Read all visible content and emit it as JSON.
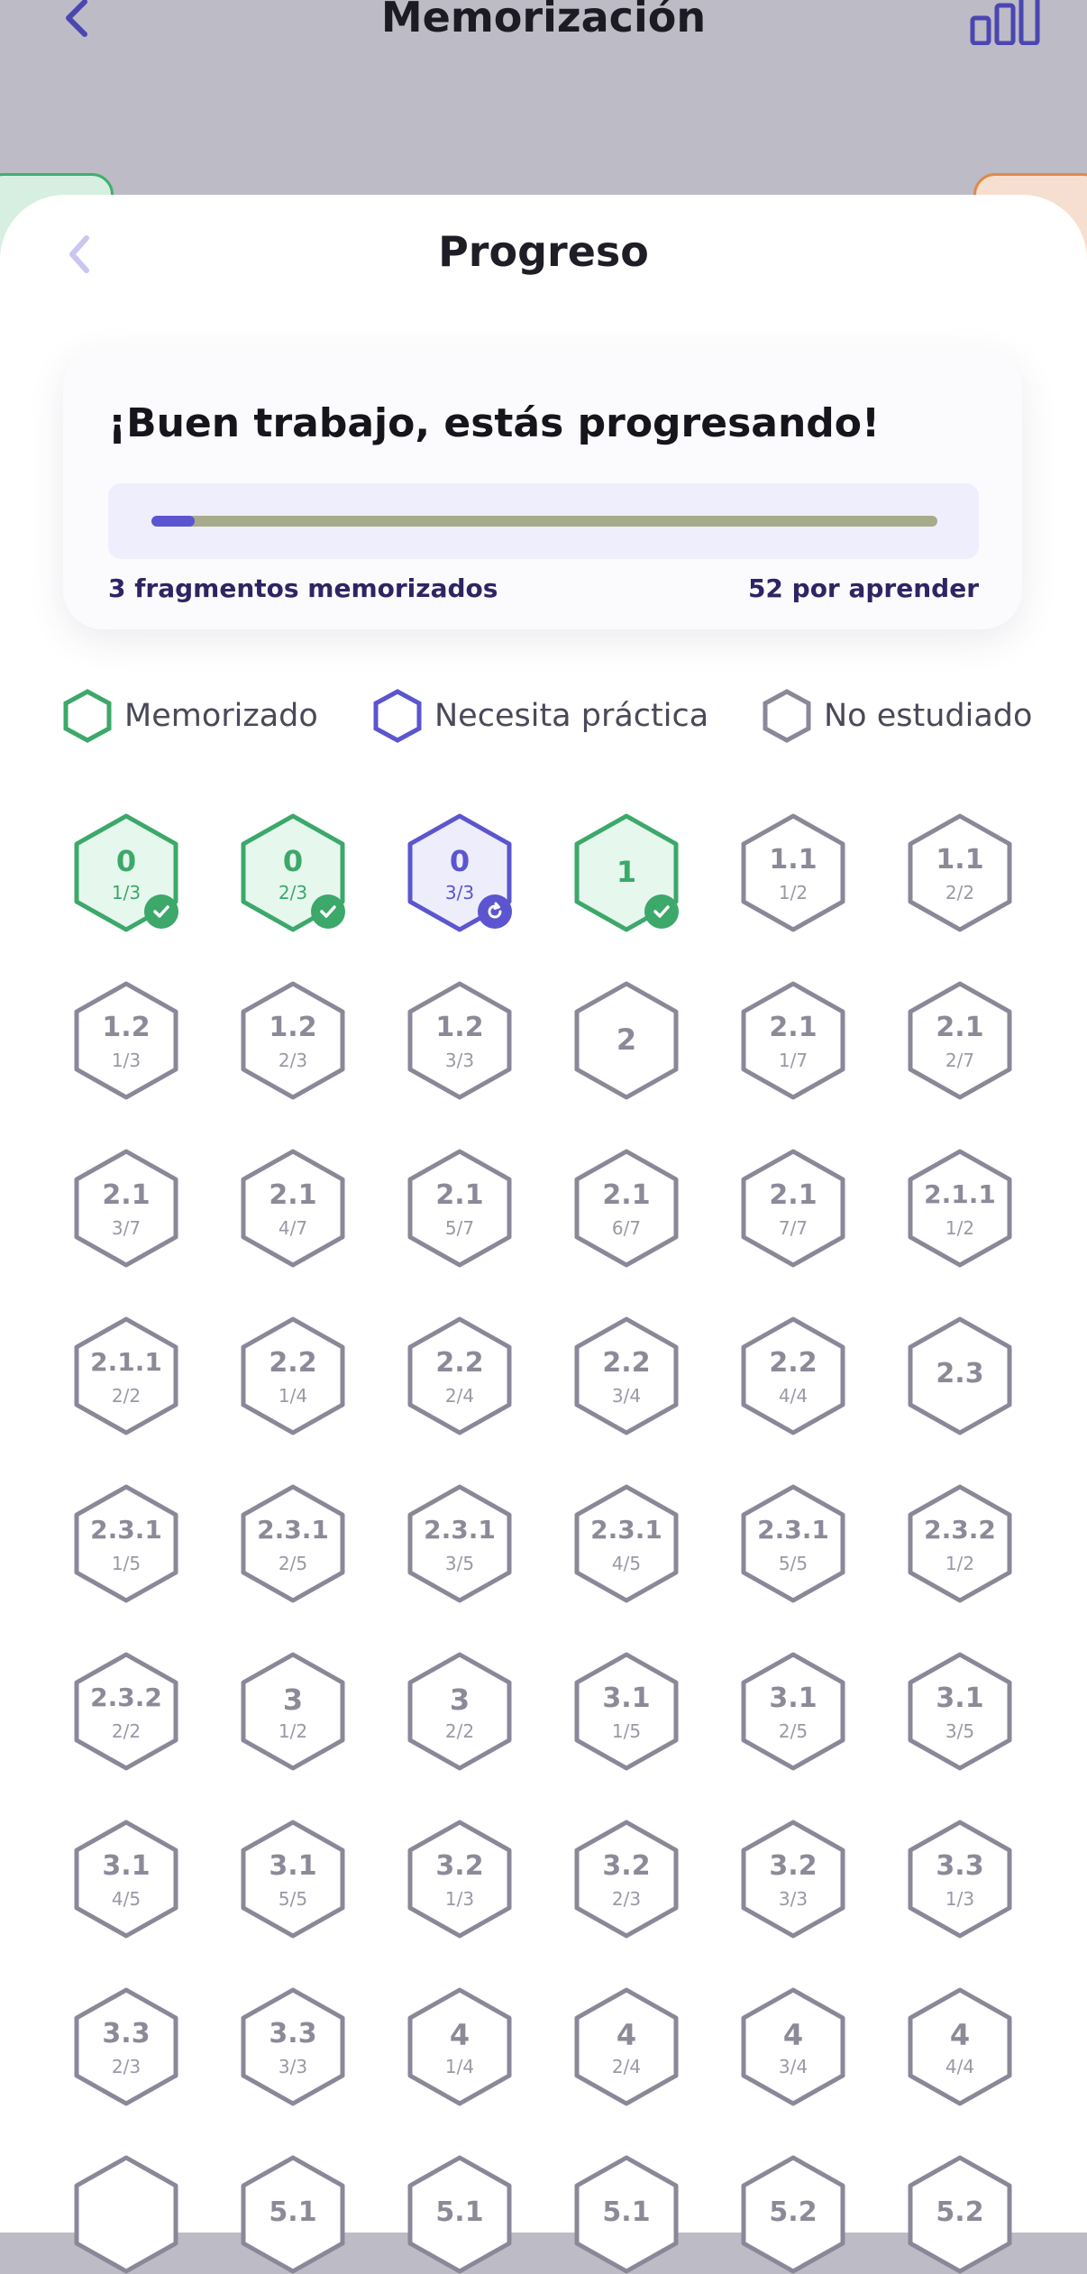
{
  "app_title": "Memorización",
  "sheet_title": "Progreso",
  "progress": {
    "headline": "¡Buen trabajo, estás progresando!",
    "memorized_text": "3 fragmentos memorizados",
    "remaining_text": "52 por aprender",
    "fraction": 0.055
  },
  "legend": [
    {
      "label": "Memorizado",
      "state": "memorized"
    },
    {
      "label": "Necesita práctica",
      "state": "practice"
    },
    {
      "label": "No estudiado",
      "state": "unstudied"
    }
  ],
  "colors": {
    "memorized": "#3ca86a",
    "practice": "#5b55cf",
    "unstudied": "#8a8898",
    "accent": "#5b55cf"
  },
  "fragments": [
    {
      "main": "0",
      "sub": "1/3",
      "state": "memorized"
    },
    {
      "main": "0",
      "sub": "2/3",
      "state": "memorized"
    },
    {
      "main": "0",
      "sub": "3/3",
      "state": "practice"
    },
    {
      "main": "1",
      "sub": "",
      "state": "memorized"
    },
    {
      "main": "1.1",
      "sub": "1/2",
      "state": "unstudied"
    },
    {
      "main": "1.1",
      "sub": "2/2",
      "state": "unstudied"
    },
    {
      "main": "1.2",
      "sub": "1/3",
      "state": "unstudied"
    },
    {
      "main": "1.2",
      "sub": "2/3",
      "state": "unstudied"
    },
    {
      "main": "1.2",
      "sub": "3/3",
      "state": "unstudied"
    },
    {
      "main": "2",
      "sub": "",
      "state": "unstudied"
    },
    {
      "main": "2.1",
      "sub": "1/7",
      "state": "unstudied"
    },
    {
      "main": "2.1",
      "sub": "2/7",
      "state": "unstudied"
    },
    {
      "main": "2.1",
      "sub": "3/7",
      "state": "unstudied"
    },
    {
      "main": "2.1",
      "sub": "4/7",
      "state": "unstudied"
    },
    {
      "main": "2.1",
      "sub": "5/7",
      "state": "unstudied"
    },
    {
      "main": "2.1",
      "sub": "6/7",
      "state": "unstudied"
    },
    {
      "main": "2.1",
      "sub": "7/7",
      "state": "unstudied"
    },
    {
      "main": "2.1.1",
      "sub": "1/2",
      "state": "unstudied"
    },
    {
      "main": "2.1.1",
      "sub": "2/2",
      "state": "unstudied"
    },
    {
      "main": "2.2",
      "sub": "1/4",
      "state": "unstudied"
    },
    {
      "main": "2.2",
      "sub": "2/4",
      "state": "unstudied"
    },
    {
      "main": "2.2",
      "sub": "3/4",
      "state": "unstudied"
    },
    {
      "main": "2.2",
      "sub": "4/4",
      "state": "unstudied"
    },
    {
      "main": "2.3",
      "sub": "",
      "state": "unstudied"
    },
    {
      "main": "2.3.1",
      "sub": "1/5",
      "state": "unstudied"
    },
    {
      "main": "2.3.1",
      "sub": "2/5",
      "state": "unstudied"
    },
    {
      "main": "2.3.1",
      "sub": "3/5",
      "state": "unstudied"
    },
    {
      "main": "2.3.1",
      "sub": "4/5",
      "state": "unstudied"
    },
    {
      "main": "2.3.1",
      "sub": "5/5",
      "state": "unstudied"
    },
    {
      "main": "2.3.2",
      "sub": "1/2",
      "state": "unstudied"
    },
    {
      "main": "2.3.2",
      "sub": "2/2",
      "state": "unstudied"
    },
    {
      "main": "3",
      "sub": "1/2",
      "state": "unstudied"
    },
    {
      "main": "3",
      "sub": "2/2",
      "state": "unstudied"
    },
    {
      "main": "3.1",
      "sub": "1/5",
      "state": "unstudied"
    },
    {
      "main": "3.1",
      "sub": "2/5",
      "state": "unstudied"
    },
    {
      "main": "3.1",
      "sub": "3/5",
      "state": "unstudied"
    },
    {
      "main": "3.1",
      "sub": "4/5",
      "state": "unstudied"
    },
    {
      "main": "3.1",
      "sub": "5/5",
      "state": "unstudied"
    },
    {
      "main": "3.2",
      "sub": "1/3",
      "state": "unstudied"
    },
    {
      "main": "3.2",
      "sub": "2/3",
      "state": "unstudied"
    },
    {
      "main": "3.2",
      "sub": "3/3",
      "state": "unstudied"
    },
    {
      "main": "3.3",
      "sub": "1/3",
      "state": "unstudied"
    },
    {
      "main": "3.3",
      "sub": "2/3",
      "state": "unstudied"
    },
    {
      "main": "3.3",
      "sub": "3/3",
      "state": "unstudied"
    },
    {
      "main": "4",
      "sub": "1/4",
      "state": "unstudied"
    },
    {
      "main": "4",
      "sub": "2/4",
      "state": "unstudied"
    },
    {
      "main": "4",
      "sub": "3/4",
      "state": "unstudied"
    },
    {
      "main": "4",
      "sub": "4/4",
      "state": "unstudied"
    },
    {
      "main": "",
      "sub": "",
      "state": "unstudied"
    },
    {
      "main": "5.1",
      "sub": "",
      "state": "unstudied"
    },
    {
      "main": "5.1",
      "sub": "",
      "state": "unstudied"
    },
    {
      "main": "5.1",
      "sub": "",
      "state": "unstudied"
    },
    {
      "main": "5.2",
      "sub": "",
      "state": "unstudied"
    },
    {
      "main": "5.2",
      "sub": "",
      "state": "unstudied"
    }
  ]
}
